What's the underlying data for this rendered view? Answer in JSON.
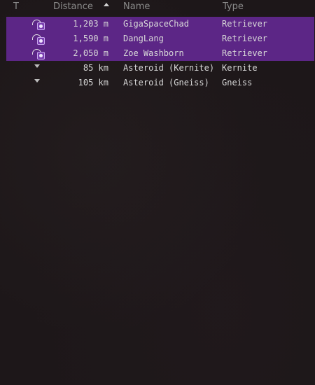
{
  "columns": {
    "type_short": "T",
    "distance": "Distance",
    "name": "Name",
    "type": "Type"
  },
  "rows": [
    {
      "icon": "hostile-ship-icon",
      "distance": "1,203 m",
      "name": "GigaSpaceChad",
      "type": "Retriever",
      "highlighted": true
    },
    {
      "icon": "hostile-ship-icon",
      "distance": "1,590 m",
      "name": "DangLang",
      "type": "Retriever",
      "highlighted": true
    },
    {
      "icon": "hostile-ship-icon",
      "distance": "2,050 m",
      "name": "Zoe Washborn",
      "type": "Retriever",
      "highlighted": true
    },
    {
      "icon": "asteroid-icon",
      "distance": "85 km",
      "name": "Asteroid (Kernite)",
      "type": "Kernite",
      "highlighted": false
    },
    {
      "icon": "asteroid-icon",
      "distance": "105 km",
      "name": "Asteroid (Gneiss)",
      "type": "Gneiss",
      "highlighted": false
    }
  ],
  "colors": {
    "highlight": "#5c2686",
    "background": "#1d1719",
    "text": "#d8d8d8",
    "header_text": "#8a8a8a"
  }
}
